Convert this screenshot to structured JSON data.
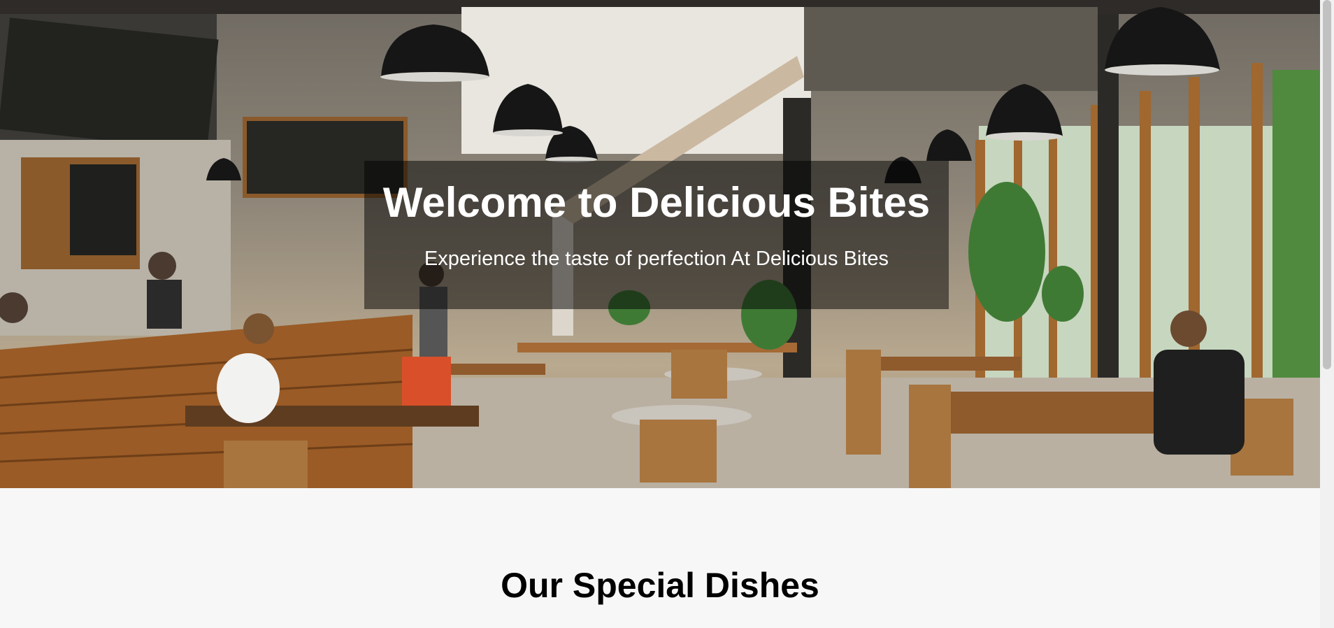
{
  "hero": {
    "title": "Welcome to Delicious Bites",
    "subtitle": "Experience the taste of perfection At Delicious Bites",
    "image": "cafe-interior-photo"
  },
  "specials": {
    "title": "Our Special Dishes"
  },
  "colors": {
    "page_background": "#f7f7f7",
    "hero_overlay": "rgba(0,0,0,0.5)",
    "hero_text": "#ffffff",
    "heading_text": "#000000"
  }
}
